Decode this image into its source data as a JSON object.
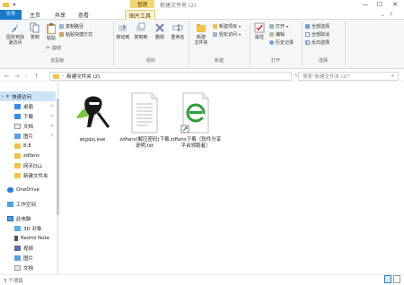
{
  "titlebar": {
    "manage_tab": "管理",
    "title": "新建文件夹 (2)",
    "minimize": "—",
    "maximize": "☐",
    "close": "✕"
  },
  "tabs": [
    "文件",
    "主页",
    "共享",
    "查看",
    "图片工具"
  ],
  "ribbon": {
    "pin_quick": "固定到快速访问",
    "copy": "复制",
    "paste": "粘贴",
    "copy_path": "复制路径",
    "paste_shortcut": "粘贴快捷方式",
    "cut": "剪切",
    "move_to": "移动到",
    "copy_to": "复制到",
    "delete": "删除",
    "rename": "重命名",
    "new_folder": "新建\n文件夹",
    "new_item": "新建项目",
    "easy_access": "轻松访问",
    "properties": "属性",
    "open": "打开",
    "edit": "编辑",
    "history": "历史记录",
    "select_all": "全部选择",
    "select_none": "全部取消",
    "invert": "反向选择",
    "group_clipboard": "剪贴板",
    "group_organize": "组织",
    "group_new": "新建",
    "group_open": "打开",
    "group_select": "选择"
  },
  "address": {
    "path_segment": "新建文件夹 (2)",
    "search_placeholder": "搜索\"新建文件夹 (2)\""
  },
  "sidebar": {
    "items": [
      {
        "label": "快速访问",
        "icon": "star-icon",
        "selected": true
      },
      {
        "label": "桌面",
        "icon": "desktop-icon"
      },
      {
        "label": "下载",
        "icon": "download-icon"
      },
      {
        "label": "文档",
        "icon": "document-icon"
      },
      {
        "label": "图片",
        "icon": "picture-icon"
      },
      {
        "label": "8.8",
        "icon": "folder-icon"
      },
      {
        "label": "zdfans",
        "icon": "folder-icon"
      },
      {
        "label": "网天DLL",
        "icon": "folder-icon"
      },
      {
        "label": "新建文件夹",
        "icon": "folder-icon"
      },
      {
        "label": "OneDrive",
        "icon": "cloud-icon"
      },
      {
        "label": "工作空间",
        "icon": "workspace-icon"
      },
      {
        "label": "此电脑",
        "icon": "computer-icon"
      },
      {
        "label": "3D 对象",
        "icon": "cube-icon"
      },
      {
        "label": "Redmi Note",
        "icon": "phone-icon"
      },
      {
        "label": "视频",
        "icon": "video-icon"
      },
      {
        "label": "图片",
        "icon": "picture-icon"
      },
      {
        "label": "文档",
        "icon": "document-icon"
      }
    ]
  },
  "files": [
    {
      "name": "wjgqsj.exe",
      "icon": "ninja-app-icon"
    },
    {
      "name": "zdfans(解压密码)下载说明.txt",
      "icon": "text-file-icon"
    },
    {
      "name": "zdfans下载（软件分享平台领跑者）",
      "icon": "ie-shortcut-icon"
    }
  ],
  "status": {
    "count": "3 个项目"
  },
  "colors": {
    "file_tab": "#1979ca",
    "manage_tab": "#f3d67a",
    "selected": "#cce4f7",
    "folder": "#f1c24b"
  }
}
